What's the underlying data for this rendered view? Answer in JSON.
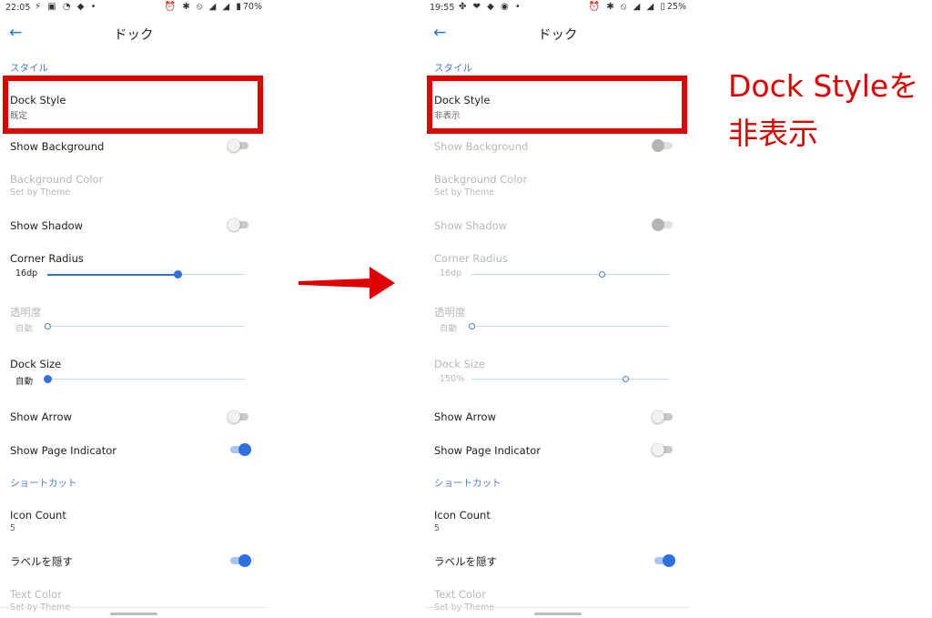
{
  "screens": [
    {
      "status": {
        "time": "22:05",
        "battery": "70%"
      },
      "appbar": {
        "title": "ドック"
      },
      "section_style": "スタイル",
      "dock_style": {
        "title": "Dock Style",
        "value": "既定"
      },
      "show_background": "Show Background",
      "background_color": {
        "title": "Background Color",
        "sub": "Set by Theme"
      },
      "show_shadow": "Show Shadow",
      "corner_radius": {
        "title": "Corner Radius",
        "value": "16dp",
        "level": 0.66
      },
      "opacity": {
        "title": "透明度",
        "value": "自動",
        "level": 0.0
      },
      "dock_size": {
        "title": "Dock Size",
        "value": "自動",
        "level": 0.0
      },
      "show_arrow": "Show Arrow",
      "show_page_indicator": "Show Page Indicator",
      "section_shortcut": "ショートカット",
      "icon_count": {
        "title": "Icon Count",
        "value": "5"
      },
      "hide_labels": "ラベルを隠す",
      "text_color": {
        "title": "Text Color",
        "sub": "Set by Theme"
      }
    },
    {
      "status": {
        "time": "19:55",
        "battery": "25%"
      },
      "appbar": {
        "title": "ドック"
      },
      "section_style": "スタイル",
      "dock_style": {
        "title": "Dock Style",
        "value": "非表示"
      },
      "show_background": "Show Background",
      "background_color": {
        "title": "Background Color",
        "sub": "Set by Theme"
      },
      "show_shadow": "Show Shadow",
      "corner_radius": {
        "title": "Corner Radius",
        "value": "16dp",
        "level": 0.66
      },
      "opacity": {
        "title": "透明度",
        "value": "自動",
        "level": 0.0
      },
      "dock_size": {
        "title": "Dock Size",
        "value": "150%",
        "level": 0.78
      },
      "show_arrow": "Show Arrow",
      "show_page_indicator": "Show Page Indicator",
      "section_shortcut": "ショートカット",
      "icon_count": {
        "title": "Icon Count",
        "value": "5"
      },
      "hide_labels": "ラベルを隠す",
      "text_color": {
        "title": "Text Color",
        "sub": "Set by Theme"
      }
    }
  ],
  "annotation": {
    "line1": "Dock Styleを",
    "line2": "非表示"
  },
  "colors": {
    "accent": "#2f6fe0",
    "highlight": "#e00000"
  },
  "icons": {
    "back": "arrow-back-icon",
    "transition": "red-arrow-right"
  }
}
